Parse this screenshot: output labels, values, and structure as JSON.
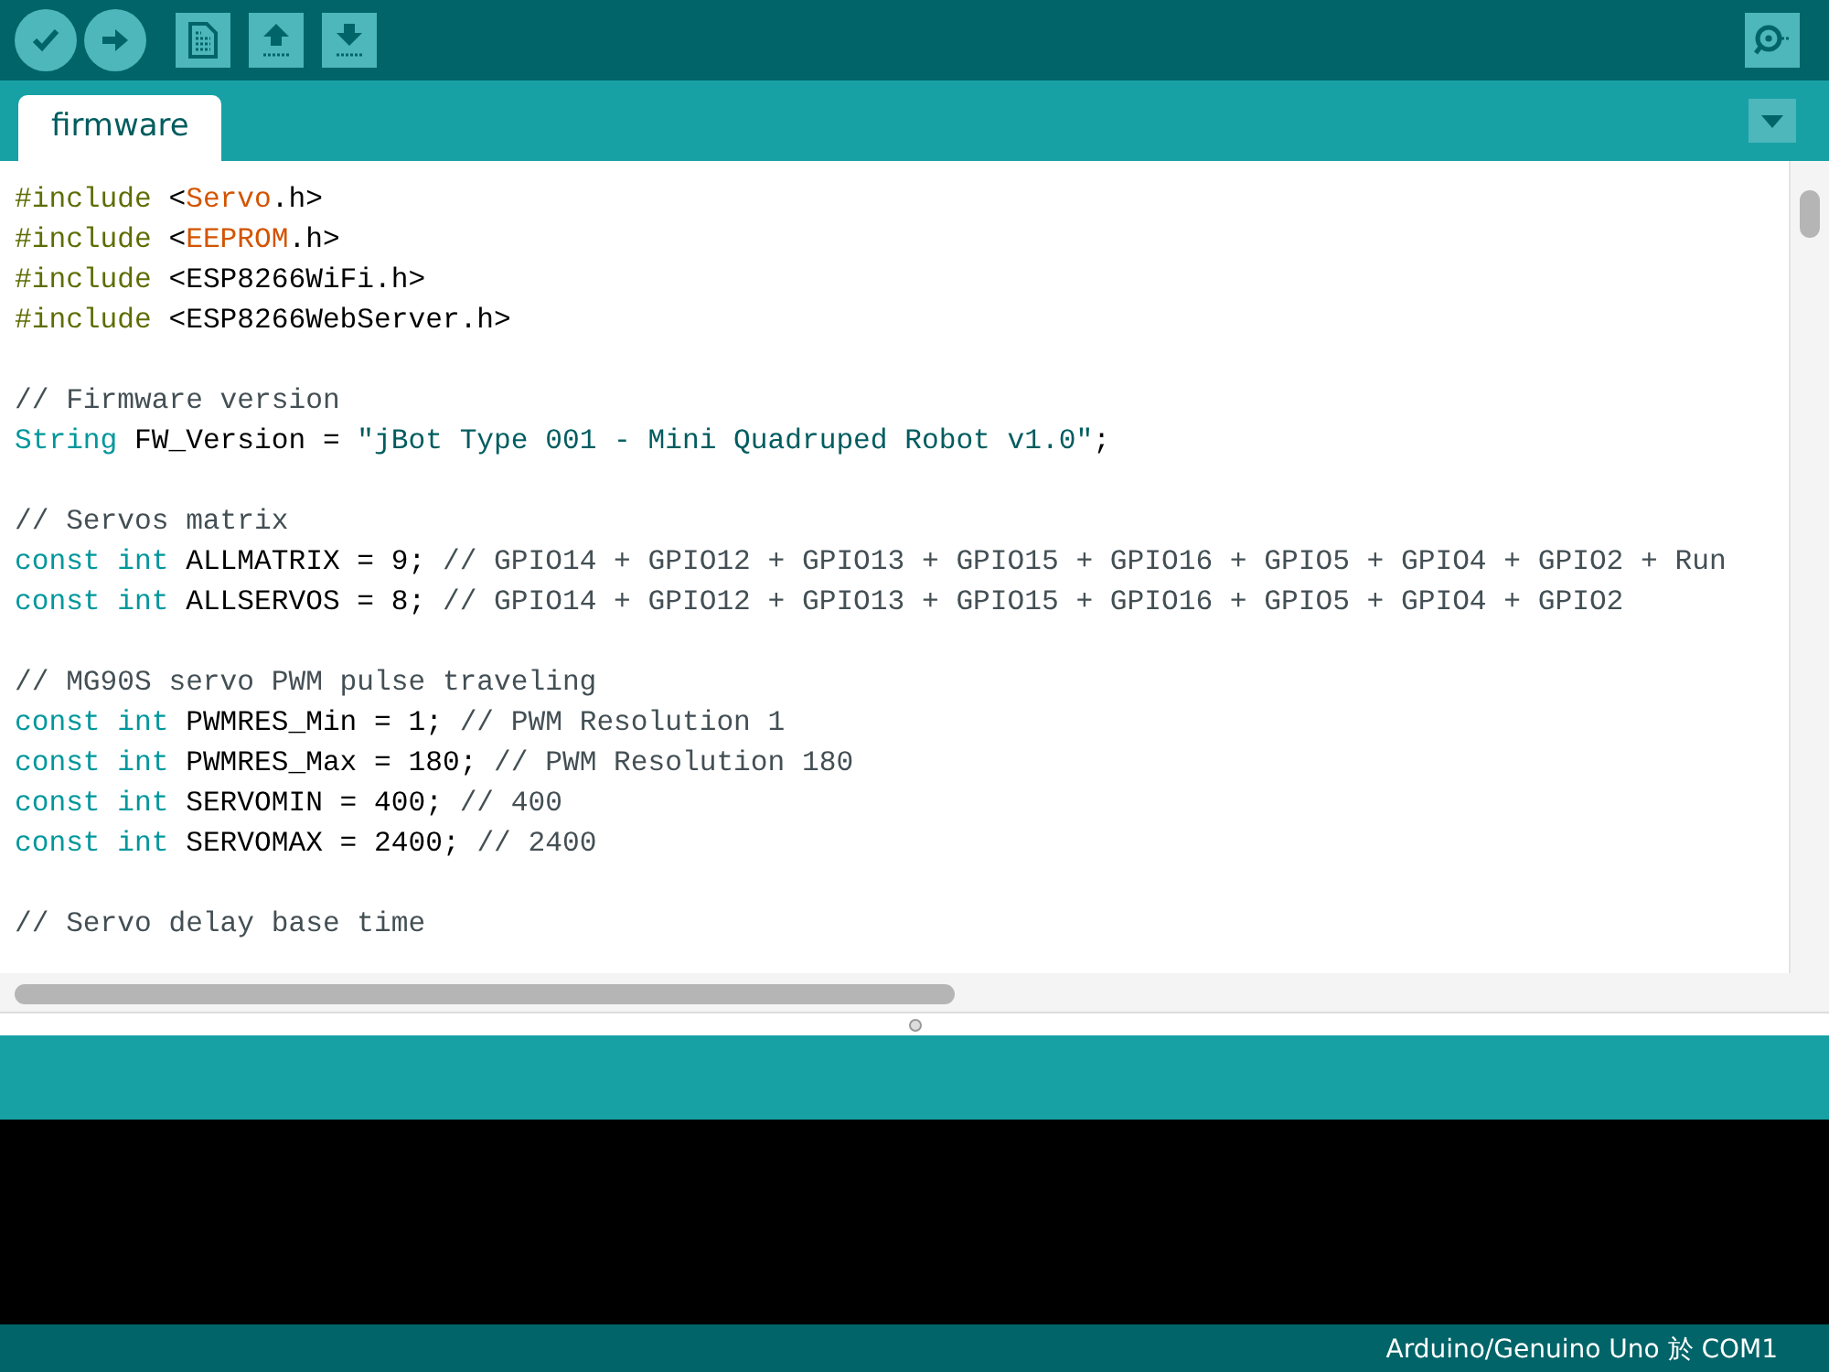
{
  "toolbar": {
    "buttons": [
      {
        "kind": "verify"
      },
      {
        "kind": "upload"
      },
      {
        "kind": "new"
      },
      {
        "kind": "open"
      },
      {
        "kind": "save"
      }
    ],
    "right_button": {
      "kind": "serial-monitor"
    }
  },
  "tabs": [
    {
      "label": "firmware",
      "selected": true
    }
  ],
  "code": {
    "blocks": [
      [
        [
          {
            "text": "#include",
            "kind": "directive"
          },
          {
            "text": " <",
            "kind": "plain"
          },
          {
            "text": "Servo",
            "kind": "lib"
          },
          {
            "text": ".h>",
            "kind": "plain"
          }
        ],
        [
          {
            "text": "#include",
            "kind": "directive"
          },
          {
            "text": " <",
            "kind": "plain"
          },
          {
            "text": "EEPROM",
            "kind": "lib"
          },
          {
            "text": ".h>",
            "kind": "plain"
          }
        ],
        [
          {
            "text": "#include",
            "kind": "directive"
          },
          {
            "text": " <ESP8266WiFi.h>",
            "kind": "plain"
          }
        ],
        [
          {
            "text": "#include",
            "kind": "directive"
          },
          {
            "text": " <ESP8266WebServer.h>",
            "kind": "plain"
          }
        ]
      ],
      [
        [
          {
            "text": "// Firmware version",
            "kind": "comment"
          }
        ],
        [
          {
            "text": "String",
            "kind": "keyword"
          },
          {
            "text": " FW_Version = ",
            "kind": "plain"
          },
          {
            "text": "\"jBot Type 001 - Mini Quadruped Robot v1.0\"",
            "kind": "string"
          },
          {
            "text": ";",
            "kind": "plain"
          }
        ]
      ],
      [
        [
          {
            "text": "// Servos matrix",
            "kind": "comment"
          }
        ],
        [
          {
            "text": "const int",
            "kind": "keyword"
          },
          {
            "text": " ALLMATRIX = 9; ",
            "kind": "plain"
          },
          {
            "text": "// GPIO14 + GPIO12 + GPIO13 + GPIO15 + GPIO16 + GPIO5 + GPIO4 + GPIO2 + Run",
            "kind": "comment"
          }
        ],
        [
          {
            "text": "const int",
            "kind": "keyword"
          },
          {
            "text": " ALLSERVOS = 8; ",
            "kind": "plain"
          },
          {
            "text": "// GPIO14 + GPIO12 + GPIO13 + GPIO15 + GPIO16 + GPIO5 + GPIO4 + GPIO2",
            "kind": "comment"
          }
        ]
      ],
      [
        [
          {
            "text": "// MG90S servo PWM pulse traveling",
            "kind": "comment"
          }
        ],
        [
          {
            "text": "const int",
            "kind": "keyword"
          },
          {
            "text": " PWMRES_Min = 1; ",
            "kind": "plain"
          },
          {
            "text": "// PWM Resolution 1",
            "kind": "comment"
          }
        ],
        [
          {
            "text": "const int",
            "kind": "keyword"
          },
          {
            "text": " PWMRES_Max = 180; ",
            "kind": "plain"
          },
          {
            "text": "// PWM Resolution 180",
            "kind": "comment"
          }
        ],
        [
          {
            "text": "const int",
            "kind": "keyword"
          },
          {
            "text": " SERVOMIN = 400; ",
            "kind": "plain"
          },
          {
            "text": "// 400",
            "kind": "comment"
          }
        ],
        [
          {
            "text": "const int",
            "kind": "keyword"
          },
          {
            "text": " SERVOMAX = 2400; ",
            "kind": "plain"
          },
          {
            "text": "// 2400",
            "kind": "comment"
          }
        ]
      ],
      [
        [
          {
            "text": "// Servo delay base time",
            "kind": "comment"
          }
        ]
      ]
    ]
  },
  "status_bar": {
    "text": "Arduino/Genuino Uno 於 COM1"
  }
}
